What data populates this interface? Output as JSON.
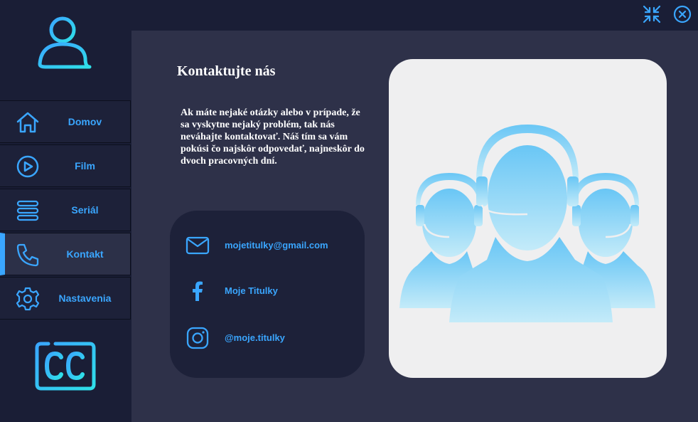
{
  "window": {
    "minimize_icon": "compress-arrows-icon",
    "close_icon": "close-circle-icon"
  },
  "sidebar": {
    "items": [
      {
        "label": "Domov",
        "icon": "home-icon",
        "active": false
      },
      {
        "label": "Film",
        "icon": "play-circle-icon",
        "active": false
      },
      {
        "label": "Seriál",
        "icon": "stack-icon",
        "active": false
      },
      {
        "label": "Kontakt",
        "icon": "phone-icon",
        "active": true
      },
      {
        "label": "Nastavenia",
        "icon": "gear-icon",
        "active": false
      }
    ]
  },
  "main": {
    "title": "Kontaktujte nás",
    "description": "Ak máte nejaké otázky alebo v prípade, že sa vyskytne nejaký problém, tak nás neváhajte kontaktovať. Náš tím sa vám pokúsi čo najskôr odpovedať, najneskôr do dvoch pracovných dní.",
    "contacts": [
      {
        "label": "mojetitulky@gmail.com",
        "icon": "mail-icon"
      },
      {
        "label": "Moje Titulky",
        "icon": "facebook-icon"
      },
      {
        "label": "@moje.titulky",
        "icon": "instagram-icon"
      }
    ]
  },
  "colors": {
    "accent": "#3aa6ff",
    "sidebar_bg": "#1a1e36",
    "main_bg": "#2e3149",
    "card_bg": "#1d2139"
  }
}
